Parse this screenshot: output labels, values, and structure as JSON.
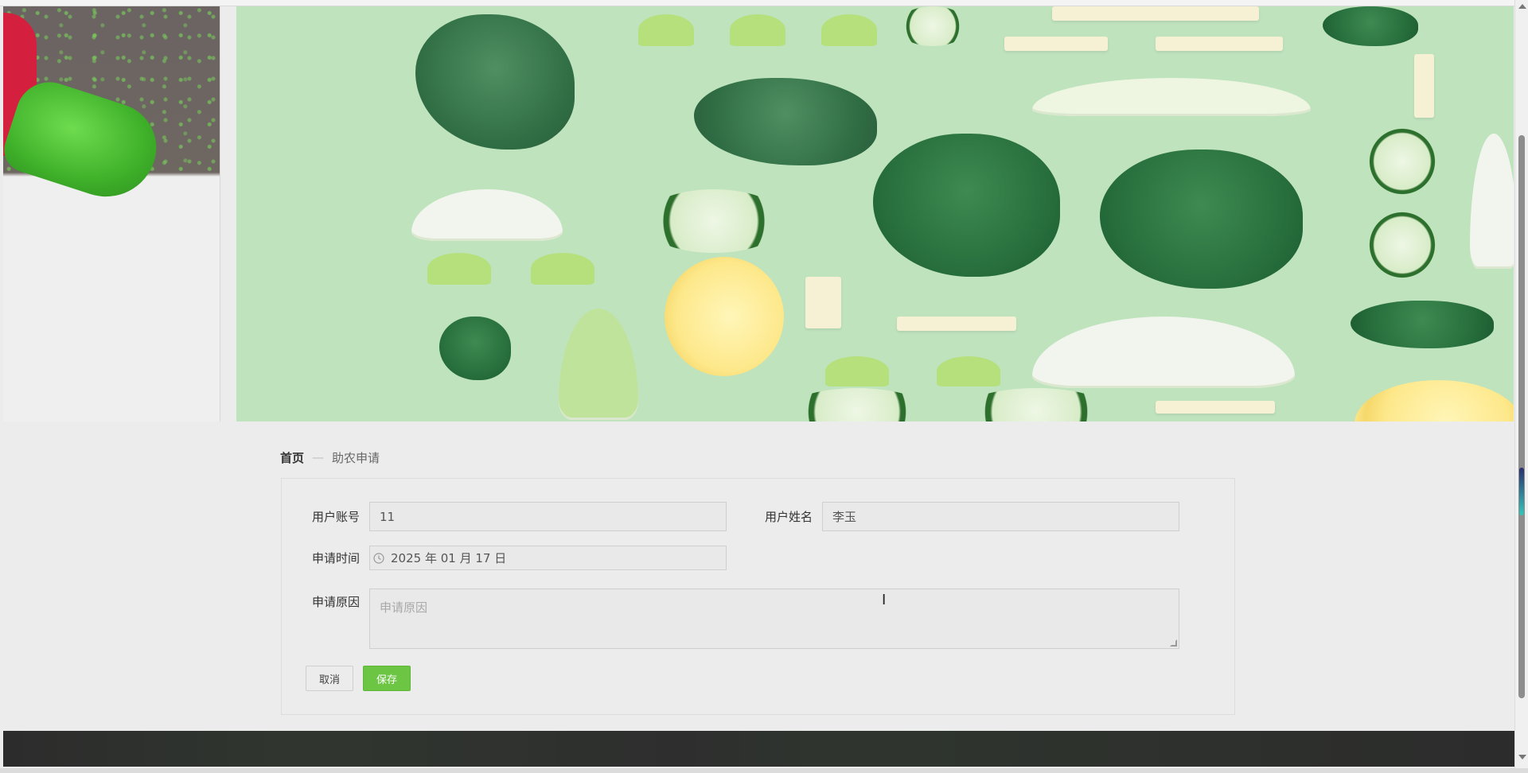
{
  "breadcrumb": {
    "home": "首页",
    "separator": "—",
    "current": "助农申请"
  },
  "form": {
    "account": {
      "label": "用户账号",
      "value": "11"
    },
    "name": {
      "label": "用户姓名",
      "value": "李玉"
    },
    "apply_time": {
      "label": "申请时间",
      "value": "2025 年 01 月 17 日",
      "icon": "clock-icon"
    },
    "reason": {
      "label": "申请原因",
      "placeholder": "申请原因"
    }
  },
  "buttons": {
    "cancel": "取消",
    "save": "保存"
  },
  "colors": {
    "save_button": "#6cc644",
    "banner_bg": "#bfe3bd",
    "footer_bg": "#2c2c2c"
  }
}
